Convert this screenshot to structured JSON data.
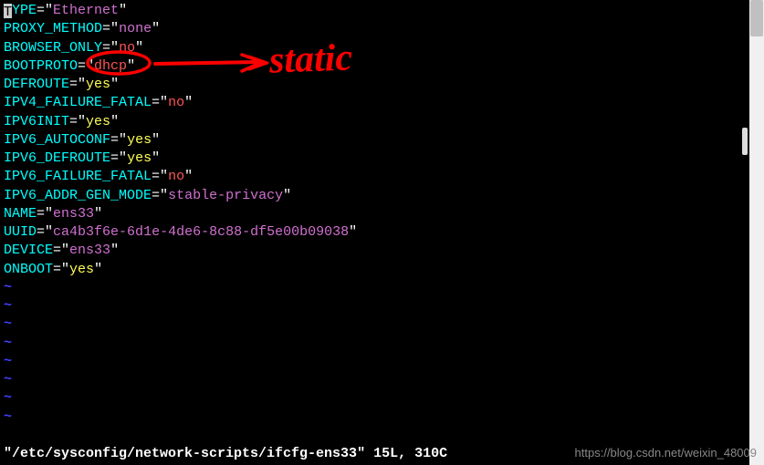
{
  "lines": [
    {
      "key": "TYPE",
      "value": "Ethernet",
      "color": "purple",
      "cursor": true
    },
    {
      "key": "PROXY_METHOD",
      "value": "none",
      "color": "purple"
    },
    {
      "key": "BROWSER_ONLY",
      "value": "no",
      "color": "red"
    },
    {
      "key": "BOOTPROTO",
      "value": "dhcp",
      "color": "red"
    },
    {
      "key": "DEFROUTE",
      "value": "yes",
      "color": "yellow"
    },
    {
      "key": "IPV4_FAILURE_FATAL",
      "value": "no",
      "color": "red"
    },
    {
      "key": "IPV6INIT",
      "value": "yes",
      "color": "yellow"
    },
    {
      "key": "IPV6_AUTOCONF",
      "value": "yes",
      "color": "yellow"
    },
    {
      "key": "IPV6_DEFROUTE",
      "value": "yes",
      "color": "yellow"
    },
    {
      "key": "IPV6_FAILURE_FATAL",
      "value": "no",
      "color": "red"
    },
    {
      "key": "IPV6_ADDR_GEN_MODE",
      "value": "stable-privacy",
      "color": "purple"
    },
    {
      "key": "NAME",
      "value": "ens33",
      "color": "purple"
    },
    {
      "key": "UUID",
      "value": "ca4b3f6e-6d1e-4de6-8c88-df5e00b09038",
      "color": "purple"
    },
    {
      "key": "DEVICE",
      "value": "ens33",
      "color": "purple"
    },
    {
      "key": "ONBOOT",
      "value": "yes",
      "color": "yellow"
    }
  ],
  "tilde_count": 8,
  "status": "\"/etc/sysconfig/network-scripts/ifcfg-ens33\" 15L, 310C",
  "annotation_text": "static",
  "watermark": "https://blog.csdn.net/weixin_48009"
}
